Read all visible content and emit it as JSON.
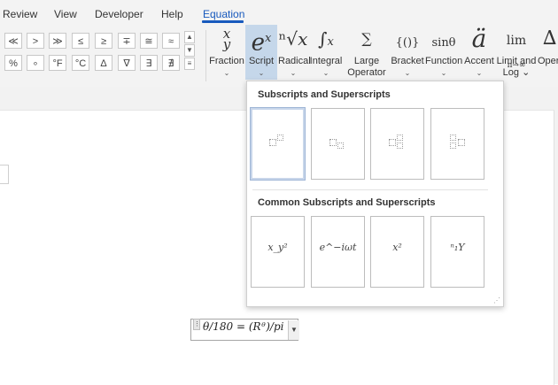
{
  "tabs": [
    {
      "label": "Review"
    },
    {
      "label": "View"
    },
    {
      "label": "Developer"
    },
    {
      "label": "Help"
    },
    {
      "label": "Equation",
      "active": true
    }
  ],
  "symbols": {
    "row1": [
      "≪",
      ">",
      "≫",
      "≤",
      "≥",
      "∓",
      "≅",
      "≈"
    ],
    "row2": [
      "%",
      "∘",
      "°F",
      "°C",
      "∆",
      "∇",
      "∃",
      "∄"
    ]
  },
  "ribbon_buttons": [
    {
      "label": "Fraction",
      "label2": "",
      "icon": "fraction-icon",
      "glyph": "x/y"
    },
    {
      "label": "Script",
      "label2": "",
      "icon": "script-icon",
      "glyph": "eˣ"
    },
    {
      "label": "Radical",
      "label2": "",
      "icon": "radical-icon",
      "glyph": "ⁿ√x"
    },
    {
      "label": "Integral",
      "label2": "",
      "icon": "integral-icon",
      "glyph": "∫"
    },
    {
      "label": "Large",
      "label2": "Operator",
      "icon": "large-operator-icon",
      "glyph": "∑"
    },
    {
      "label": "Bracket",
      "label2": "",
      "icon": "bracket-icon",
      "glyph": "{()}"
    },
    {
      "label": "Function",
      "label2": "",
      "icon": "function-icon",
      "glyph": "sinθ"
    },
    {
      "label": "Accent",
      "label2": "",
      "icon": "accent-icon",
      "glyph": "ä"
    },
    {
      "label": "Limit and",
      "label2": "Log",
      "icon": "limit-log-icon",
      "glyph": "lim"
    },
    {
      "label": "Oper",
      "label2": "",
      "icon": "operator-icon",
      "glyph": "∆"
    }
  ],
  "gallery": {
    "section1_title": "Subscripts and Superscripts",
    "section2_title": "Common Subscripts and Superscripts",
    "common": [
      {
        "text": "x_y²"
      },
      {
        "text": "e^−iωt"
      },
      {
        "text": "x²"
      },
      {
        "text": "ⁿ₁Y"
      }
    ]
  },
  "equation": {
    "text": "θ/180 = (Rᶿ)/pi"
  },
  "colors": {
    "accent": "#185abd",
    "selected_button": "#c5d7ea"
  }
}
